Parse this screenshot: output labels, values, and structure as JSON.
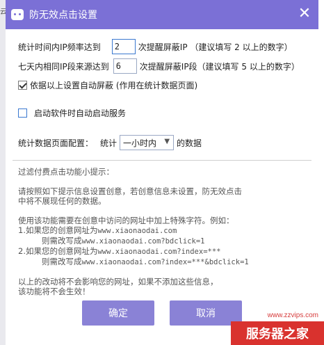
{
  "background": {
    "label": "云"
  },
  "dialog": {
    "title": "防无效点击设置",
    "close_glyph": "✕",
    "row1": {
      "prefix": "统计时间内IP频率达到",
      "value": "2",
      "suffix": "次提醒屏蔽IP  （建议填写 2 以上的数字）"
    },
    "row2": {
      "prefix": "七天内相同IP段来源达到",
      "value": "6",
      "suffix": "次提醒屏蔽IP段（建议填写 5 以上的数字）"
    },
    "auto_block": {
      "label": "依据以上设置自动屏蔽  (作用在统计数据页面)",
      "checked": true
    },
    "autostart": {
      "label": "启动软件时自动启动服务",
      "checked": false
    },
    "stats_config": {
      "label": "统计数据页面配置：",
      "prefix": "统计",
      "selected": "一小时内",
      "suffix": "的数据"
    },
    "tips": {
      "heading": "过滤付费点击功能小提示：",
      "p1_line1": "请按照如下提示信息设置创意，若创意信息未设置，防无效点击",
      "p1_line2": "中将不展现任何的数据。",
      "p2_line1": "使用该功能需要在创意中访问的网址中加上特殊字符。例如：",
      "ex1_a": "1.如果您的创意网址为",
      "ex1_url": "www.xiaonaodai.com",
      "ex1_b": "则需改写成",
      "ex1_url2": "www.xiaonaodai.com?bdclick=1",
      "ex2_a": "2.如果您的创意网址为",
      "ex2_url": "www.xiaonaodai.com?index=***",
      "ex2_b": "则需改写成",
      "ex2_url2": "www.xiaonaodai.com?index=***&bdclick=1",
      "p3_line1": "以上的改动将不会影响您的网址，如果不添加这些信息，",
      "p3_line2": "该功能将不会生效！"
    },
    "ok_label": "确定",
    "cancel_label": "取消"
  },
  "watermark": {
    "url": "www.zzvips.com",
    "text": "服务器之家"
  },
  "colors": {
    "titlebar": "#7b70d6",
    "button": "#8a82d6",
    "watermark": "#d9322e"
  }
}
